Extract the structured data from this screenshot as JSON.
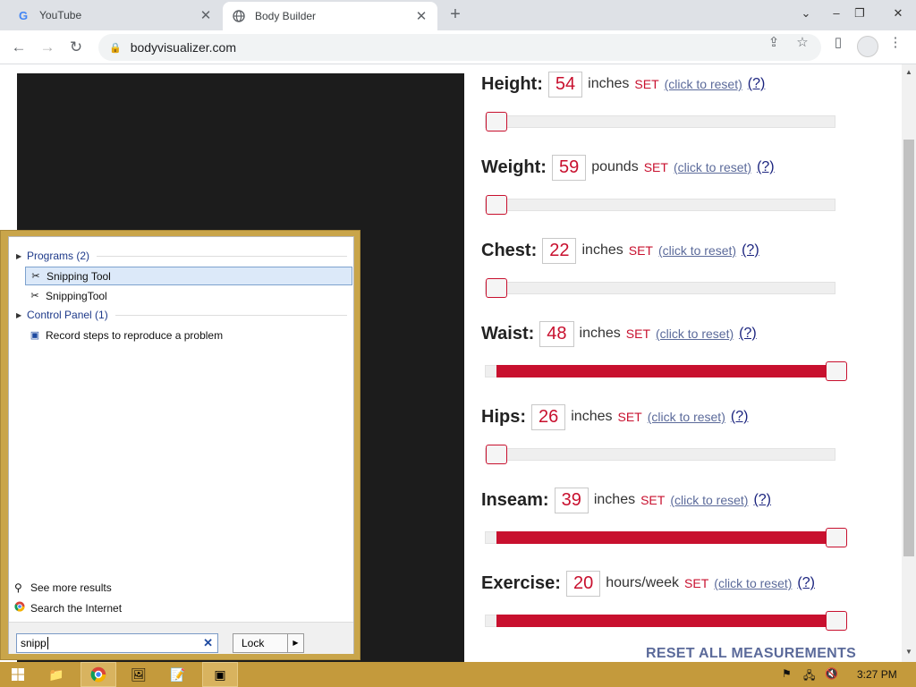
{
  "browser": {
    "tabs": [
      {
        "title": "YouTube",
        "icon": "google-icon"
      },
      {
        "title": "Body Builder",
        "icon": "globe-icon"
      }
    ],
    "url": "bodyvisualizer.com"
  },
  "measurements": [
    {
      "key": "height",
      "label": "Height:",
      "value": "54",
      "unit": "inches",
      "set": "SET",
      "reset": "(click to reset)",
      "help": "(?)",
      "level": 0.0
    },
    {
      "key": "weight",
      "label": "Weight:",
      "value": "59",
      "unit": "pounds",
      "set": "SET",
      "reset": "(click to reset)",
      "help": "(?)",
      "level": 0.0
    },
    {
      "key": "chest",
      "label": "Chest:",
      "value": "22",
      "unit": "inches",
      "set": "SET",
      "reset": "(click to reset)",
      "help": "(?)",
      "level": 0.0
    },
    {
      "key": "waist",
      "label": "Waist:",
      "value": "48",
      "unit": "inches",
      "set": "SET",
      "reset": "(click to reset)",
      "help": "(?)",
      "level": 1.0
    },
    {
      "key": "hips",
      "label": "Hips:",
      "value": "26",
      "unit": "inches",
      "set": "SET",
      "reset": "(click to reset)",
      "help": "(?)",
      "level": 0.0
    },
    {
      "key": "inseam",
      "label": "Inseam:",
      "value": "39",
      "unit": "inches",
      "set": "SET",
      "reset": "(click to reset)",
      "help": "(?)",
      "level": 1.0
    },
    {
      "key": "exercise",
      "label": "Exercise:",
      "value": "20",
      "unit": "hours/week",
      "set": "SET",
      "reset": "(click to reset)",
      "help": "(?)",
      "level": 1.0
    }
  ],
  "reset_all": "RESET ALL MEASUREMENTS",
  "start_menu": {
    "programs_header": "Programs (2)",
    "programs": [
      "Snipping Tool",
      "SnippingTool"
    ],
    "control_panel_header": "Control Panel (1)",
    "control_panel": [
      "Record steps to reproduce a problem"
    ],
    "see_more": "See more results",
    "search_internet": "Search the Internet",
    "search_value": "snipp",
    "lock_label": "Lock"
  },
  "taskbar": {
    "clock": "3:27 PM"
  },
  "colors": {
    "accent": "#c8102e",
    "link": "#5b6a9a",
    "taskbar": "#c49a3c"
  }
}
